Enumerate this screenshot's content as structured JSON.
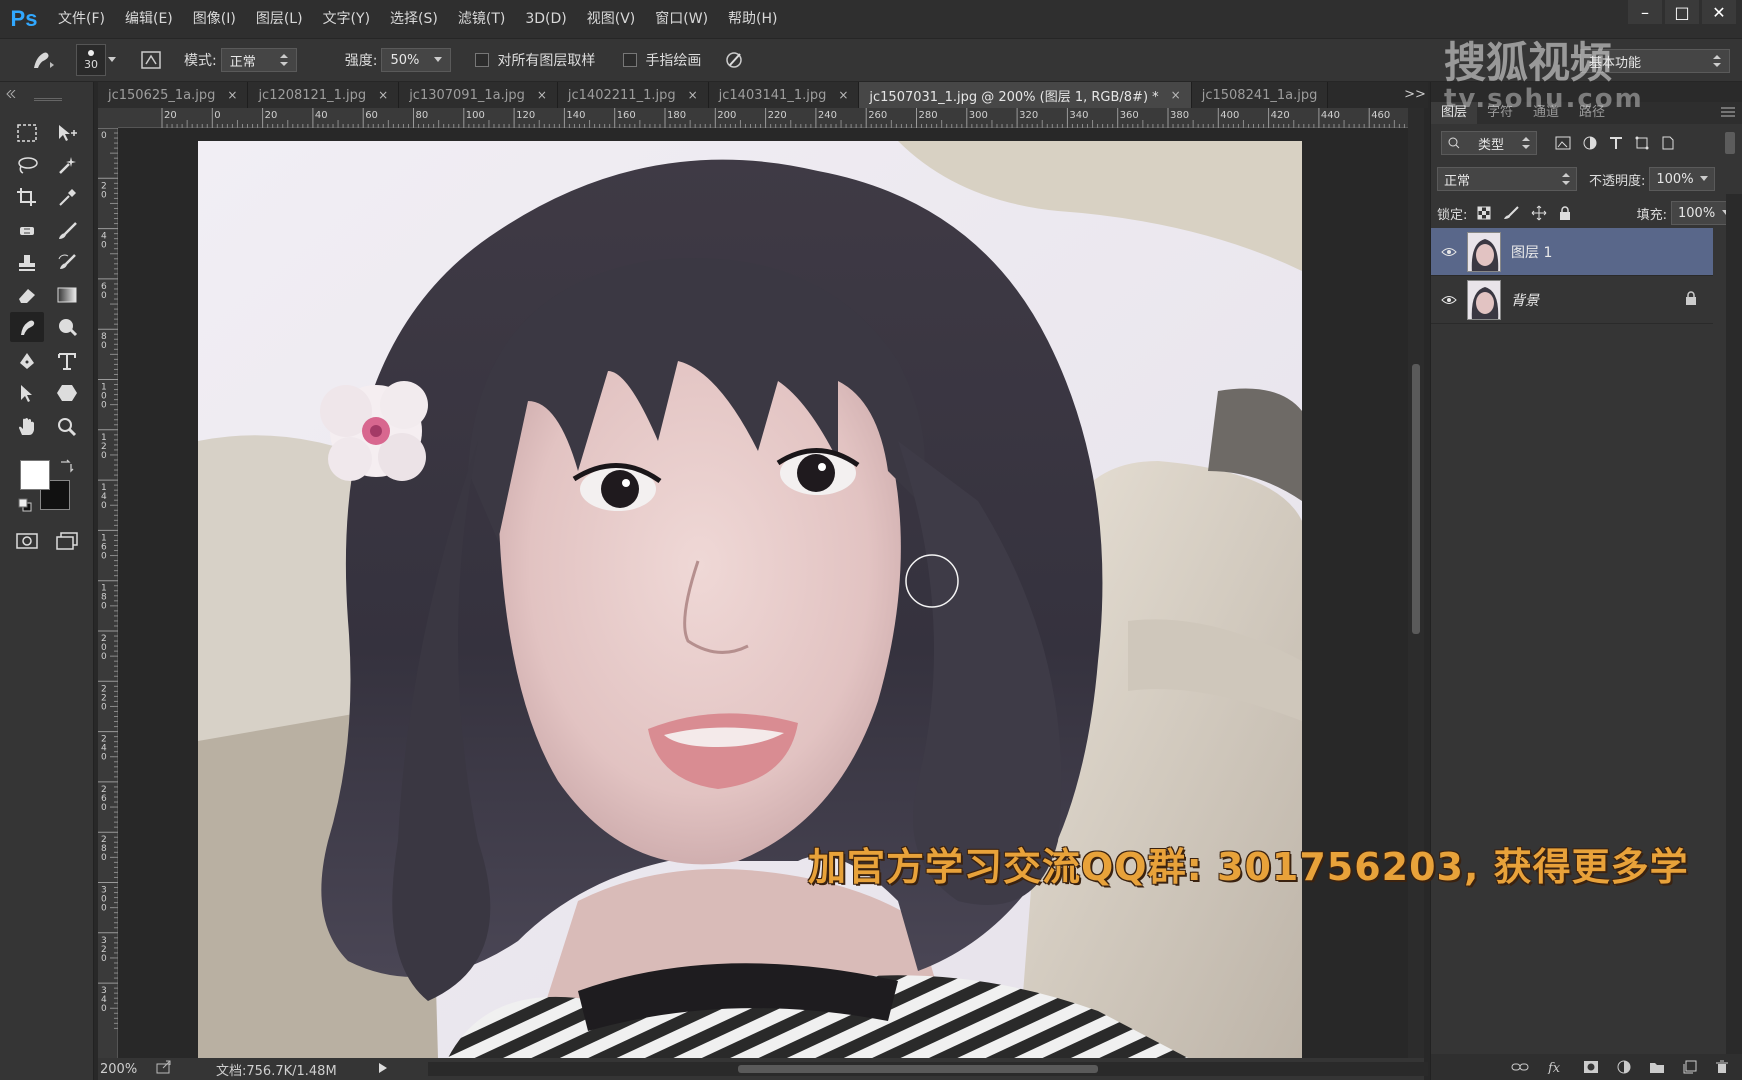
{
  "app": {
    "logo": "Ps",
    "menu": [
      "文件(F)",
      "编辑(E)",
      "图像(I)",
      "图层(L)",
      "文字(Y)",
      "选择(S)",
      "滤镜(T)",
      "3D(D)",
      "视图(V)",
      "窗口(W)",
      "帮助(H)"
    ],
    "window_controls": [
      "–",
      "□",
      "✕"
    ]
  },
  "options": {
    "brush_size": "30",
    "mode_label": "模式:",
    "mode_value": "正常",
    "strength_label": "强度:",
    "strength_value": "50%",
    "sample_all_label": "对所有图层取样",
    "finger_paint_label": "手指绘画",
    "workspace": "基本功能"
  },
  "tabs": [
    {
      "label": "jc150625_1a.jpg",
      "close": "×"
    },
    {
      "label": "jc1208121_1.jpg",
      "close": "×"
    },
    {
      "label": "jc1307091_1a.jpg",
      "close": "×"
    },
    {
      "label": "jc1402211_1.jpg",
      "close": "×"
    },
    {
      "label": "jc1403141_1.jpg",
      "close": "×"
    },
    {
      "label": "jc1507031_1.jpg @ 200% (图层 1, RGB/8#) *",
      "close": "×"
    },
    {
      "label": "jc1508241_1a.jpg",
      "close": ""
    }
  ],
  "tab_overflow": ">>",
  "ruler": {
    "h": [
      "20",
      "0",
      "20",
      "40",
      "60",
      "80",
      "100",
      "120",
      "140",
      "160",
      "180",
      "200",
      "220",
      "240",
      "260",
      "280",
      "300",
      "320",
      "340",
      "360",
      "380",
      "400",
      "420",
      "440",
      "460"
    ],
    "v": [
      "0",
      "20",
      "40",
      "60",
      "80",
      "100",
      "120",
      "140",
      "160",
      "180",
      "200",
      "220",
      "240",
      "260",
      "280",
      "300",
      "320",
      "340"
    ]
  },
  "status": {
    "zoom": "200%",
    "doc": "文档:756.7K/1.48M"
  },
  "layers_panel": {
    "tabs": [
      "图层",
      "字符",
      "通道",
      "路径"
    ],
    "filter_kind": "类型",
    "blend_mode": "正常",
    "opacity_label": "不透明度:",
    "opacity_value": "100%",
    "lock_label": "锁定:",
    "fill_label": "填充:",
    "fill_value": "100%",
    "layers": [
      {
        "name": "图层 1",
        "selected": true
      },
      {
        "name": "背景",
        "selected": false,
        "locked": true
      }
    ]
  },
  "overlay": {
    "watermark_line1": "搜狐视频",
    "watermark_line2": "tv.sohu.com",
    "subtitle": "加官方学习交流QQ群: 301756203, 获得更多学"
  }
}
